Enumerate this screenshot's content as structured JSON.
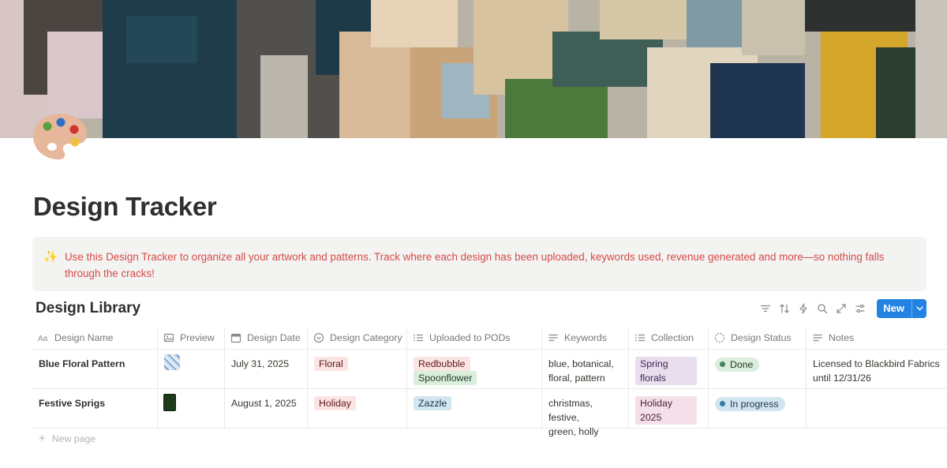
{
  "page": {
    "title": "Design Tracker",
    "callout": {
      "icon": "sparkles-icon",
      "text": "Use this Design Tracker to organize all your artwork and patterns. Track where each design has been uploaded, keywords used, revenue generated and more—so nothing falls through the cracks!"
    }
  },
  "database": {
    "title": "Design Library",
    "new_button": "New",
    "columns": [
      {
        "label": "Design Name",
        "icon": "text-aa-icon"
      },
      {
        "label": "Preview",
        "icon": "image-icon"
      },
      {
        "label": "Design Date",
        "icon": "calendar-icon"
      },
      {
        "label": "Design Category",
        "icon": "select-icon"
      },
      {
        "label": "Uploaded to PODs",
        "icon": "list-icon"
      },
      {
        "label": "Keywords",
        "icon": "text-lines-icon"
      },
      {
        "label": "Collection",
        "icon": "list-icon"
      },
      {
        "label": "Design Status",
        "icon": "status-icon"
      },
      {
        "label": "Notes",
        "icon": "text-lines-icon"
      }
    ],
    "rows": [
      {
        "name": "Blue Floral Pattern",
        "date": "July 31, 2025",
        "category": "Floral",
        "pods": [
          "Redbubble",
          "Spoonflower"
        ],
        "keywords_1": "blue, botanical,",
        "keywords_2": "floral, pattern",
        "collection": "Spring florals",
        "status": "Done",
        "notes_1": "Licensed to Blackbird Fabrics",
        "notes_2": "until 12/31/26"
      },
      {
        "name": "Festive Sprigs",
        "date": "August 1, 2025",
        "category": "Holiday",
        "pods": [
          "Zazzle"
        ],
        "keywords_1": "christmas, festive,",
        "keywords_2": "green, holly",
        "collection": "Holiday 2025",
        "status": "In progress",
        "notes_1": "",
        "notes_2": ""
      }
    ],
    "new_page": "New page"
  },
  "colors": {
    "accent": "#2383e2",
    "callout_text": "#d44c47",
    "tag_red_bg": "#fbe4e4",
    "tag_green_bg": "#dbeddb",
    "tag_blue_bg": "#d3e5ef",
    "tag_purple_bg": "#e8deee",
    "tag_pink_bg": "#f5e0e9"
  }
}
